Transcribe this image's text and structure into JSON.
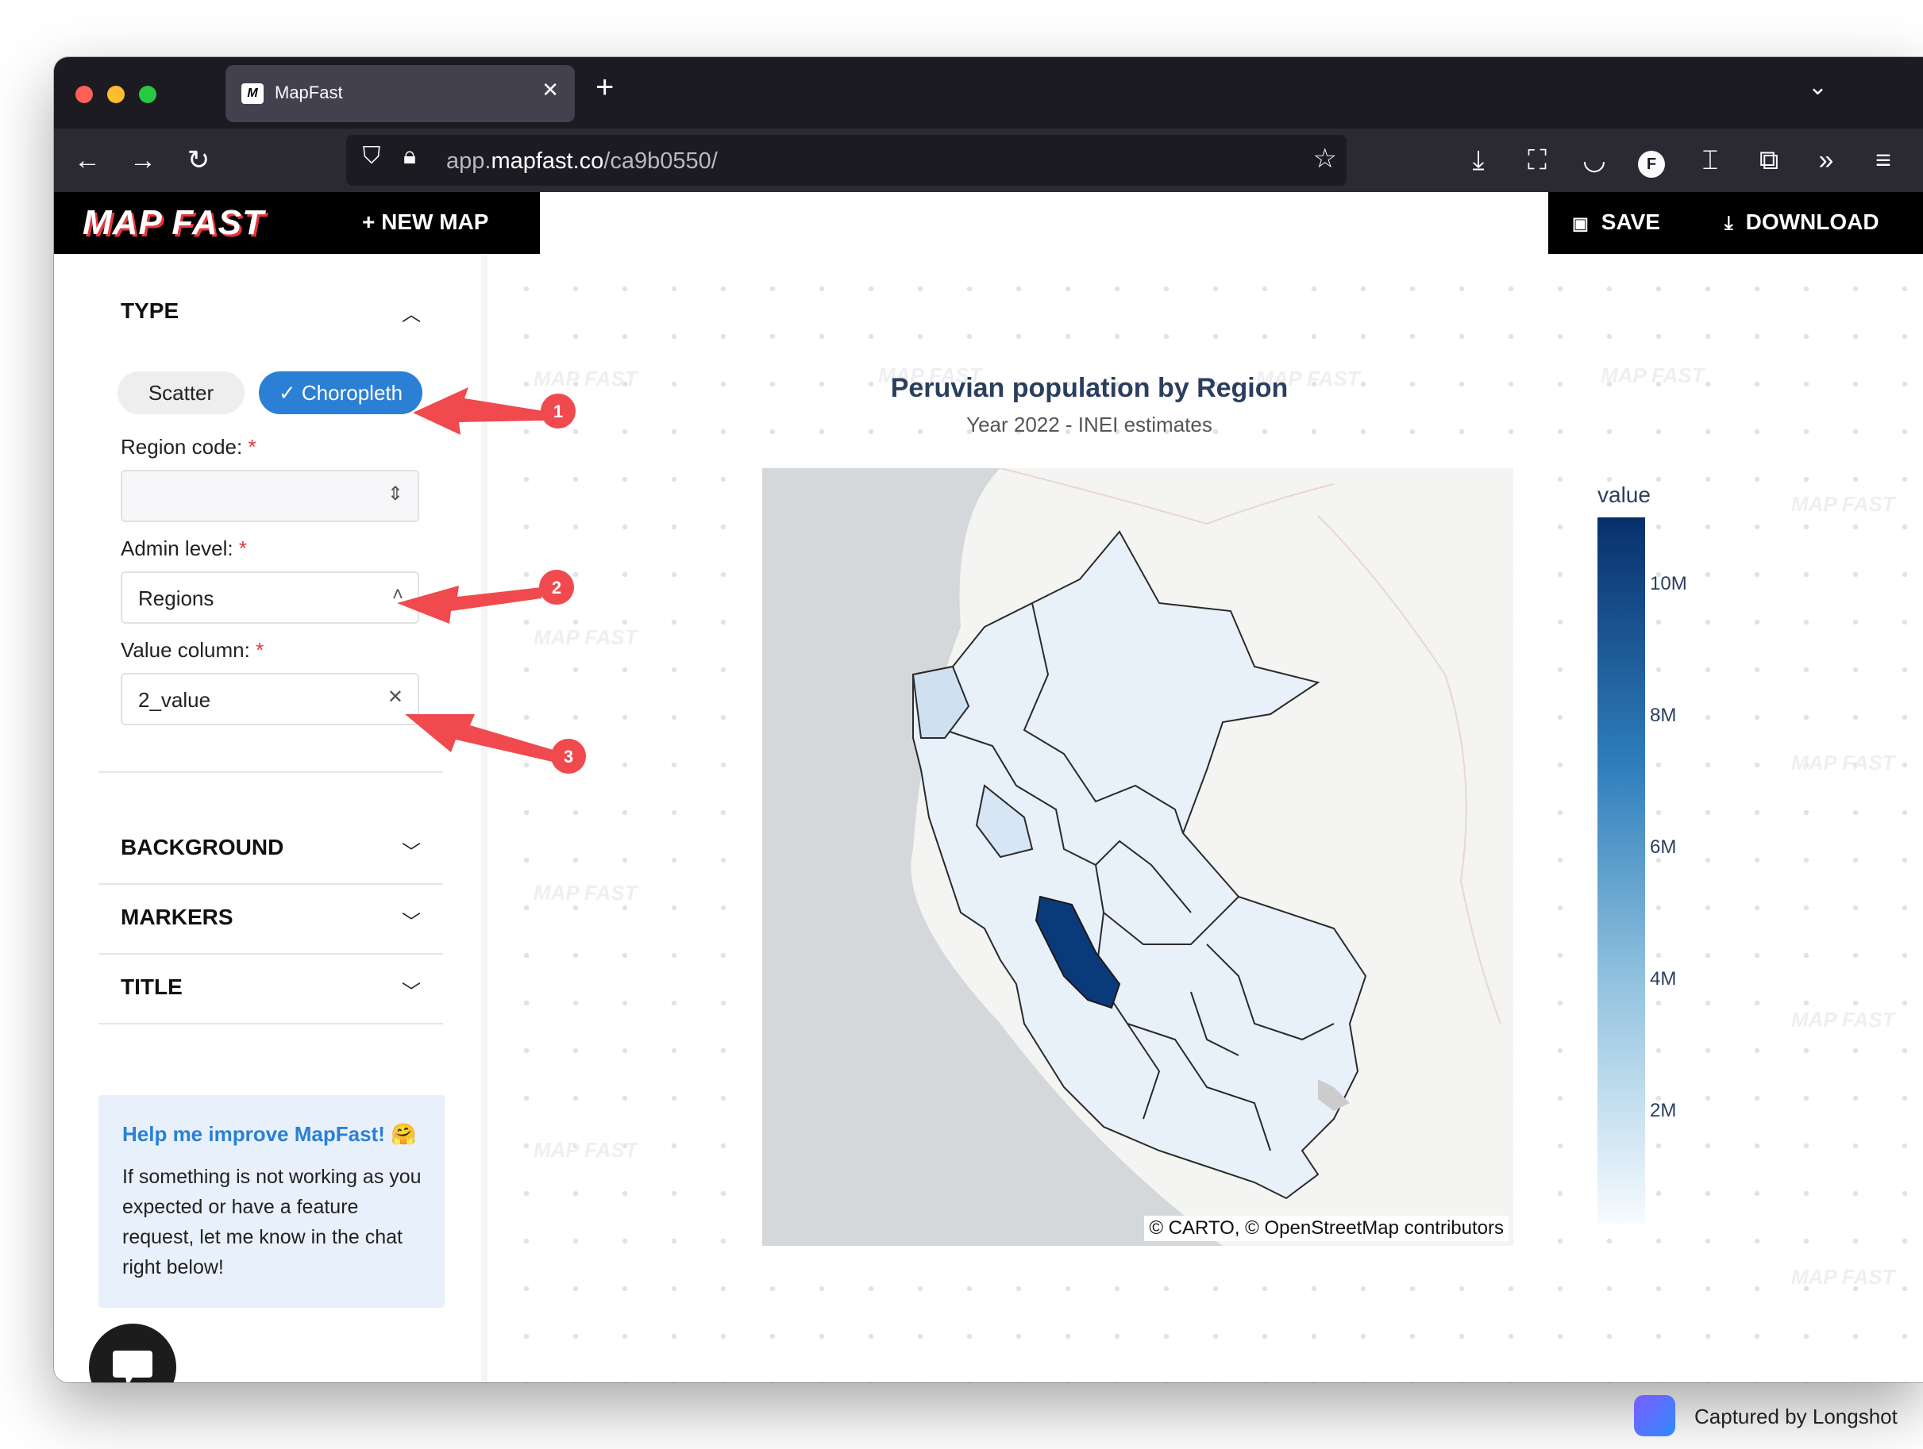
{
  "browser": {
    "tab_title": "MapFast",
    "tab_favicon": "M",
    "url_host": "app.mapfast.co",
    "url_prefix": "app.",
    "url_domain": "mapfast.co",
    "url_path": "/ca9b0550/"
  },
  "header": {
    "logo": "MAP FAST",
    "new_map": "+  NEW MAP",
    "save": "SAVE",
    "download": "DOWNLOAD"
  },
  "sidebar": {
    "type_title": "TYPE",
    "type_options": [
      "Scatter",
      "Choropleth"
    ],
    "type_selected": "Choropleth",
    "region_code_label": "Region code:",
    "region_code_value": "",
    "admin_level_label": "Admin level:",
    "admin_level_value": "Regions",
    "value_column_label": "Value column:",
    "value_column_value": "2_value",
    "required_marker": "*",
    "sections": [
      "BACKGROUND",
      "MARKERS",
      "TITLE"
    ],
    "help_title": "Help me improve MapFast! 🤗",
    "help_body": "If something is not working as you expected or have a feature request, let me know in the chat right below!"
  },
  "map": {
    "title": "Peruvian population by Region",
    "subtitle": "Year 2022 - INEI estimates",
    "attribution": "© CARTO, © OpenStreetMap contributors",
    "colorbar_title": "value",
    "colorbar_ticks": [
      "10M",
      "8M",
      "6M",
      "4M",
      "2M"
    ],
    "colorbar_tick_values": [
      10000000,
      8000000,
      6000000,
      4000000,
      2000000
    ],
    "colorbar_range": [
      0,
      10800000
    ],
    "colors": {
      "min": "#f7fbff",
      "max": "#08306b",
      "highlight": "#0b3a7a"
    },
    "watermark": "MAP FAST"
  },
  "annotations": {
    "badges": [
      "1",
      "2",
      "3"
    ],
    "color": "#f0494e"
  },
  "capture": {
    "label": "Captured by Longshot"
  }
}
